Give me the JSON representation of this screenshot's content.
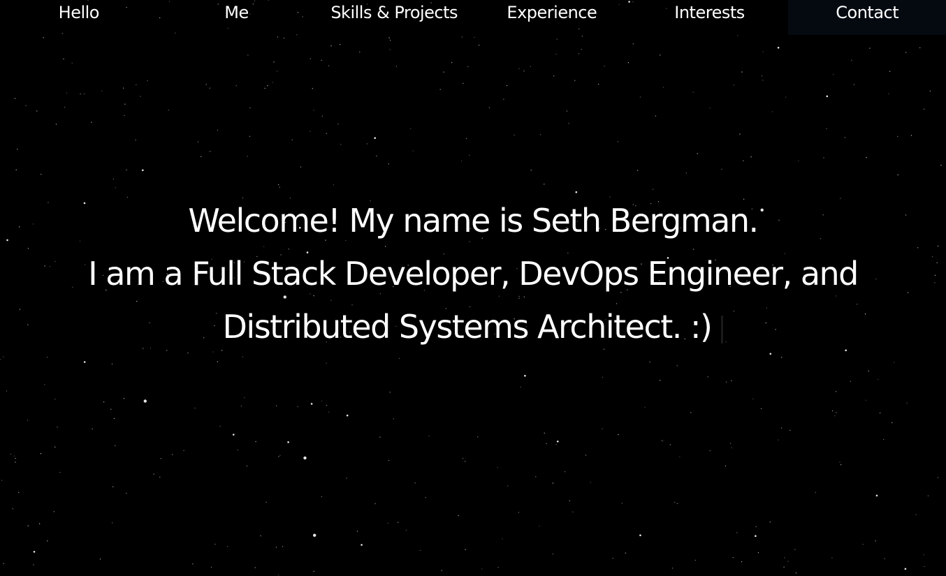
{
  "nav": {
    "items": [
      {
        "label": "Hello"
      },
      {
        "label": "Me"
      },
      {
        "label": "Skills & Projects"
      },
      {
        "label": "Experience"
      },
      {
        "label": "Interests"
      },
      {
        "label": "Contact"
      }
    ]
  },
  "hero": {
    "greeting": "Welcome! My name is Seth Bergman.",
    "tagline": "I am a Full Stack Developer, DevOps Engineer, and Distributed Systems Architect. :)"
  },
  "colors": {
    "background": "#000000",
    "text": "#ffffff",
    "active_nav_bg": "#050a10"
  }
}
